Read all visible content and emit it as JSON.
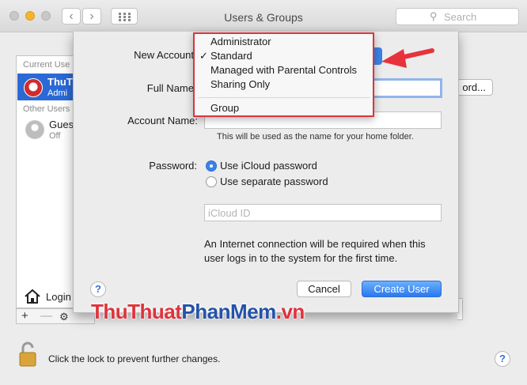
{
  "window": {
    "title": "Users & Groups",
    "search_placeholder": "Search"
  },
  "sidebar": {
    "current_users_header": "Current Use",
    "current_user_name": "ThuT",
    "current_user_role": "Admi",
    "other_users_header": "Other Users",
    "guest_name": "Gues",
    "guest_status": "Off",
    "login_options": "Login"
  },
  "behind": {
    "change_password_fragment": "ord..."
  },
  "sheet": {
    "new_account_label": "New Account",
    "full_name_label": "Full Name",
    "account_name_label": "Account Name:",
    "account_name_hint": "This will be used as the name for your home folder.",
    "password_label": "Password:",
    "password_options": [
      {
        "label": "Use iCloud password",
        "selected": true
      },
      {
        "label": "Use separate password",
        "selected": false
      }
    ],
    "icloud_id_placeholder": "iCloud ID",
    "info_line1": "An Internet connection will be required when this",
    "info_line2": "user logs in to the system for the first time.",
    "cancel": "Cancel",
    "create_user": "Create User"
  },
  "account_type_menu": {
    "items": [
      "Administrator",
      "Standard",
      "Managed with Parental Controls",
      "Sharing Only"
    ],
    "selected": "Standard",
    "group": "Group"
  },
  "footer": {
    "lock_text": "Click the lock to prevent further changes."
  },
  "watermark": {
    "part1": "ThuThuat",
    "part2": "PhanMem",
    "part3": ".vn"
  },
  "colors": {
    "accent": "#2b69d6",
    "highlight_box": "#d9363e",
    "arrow": "#e8323c"
  }
}
